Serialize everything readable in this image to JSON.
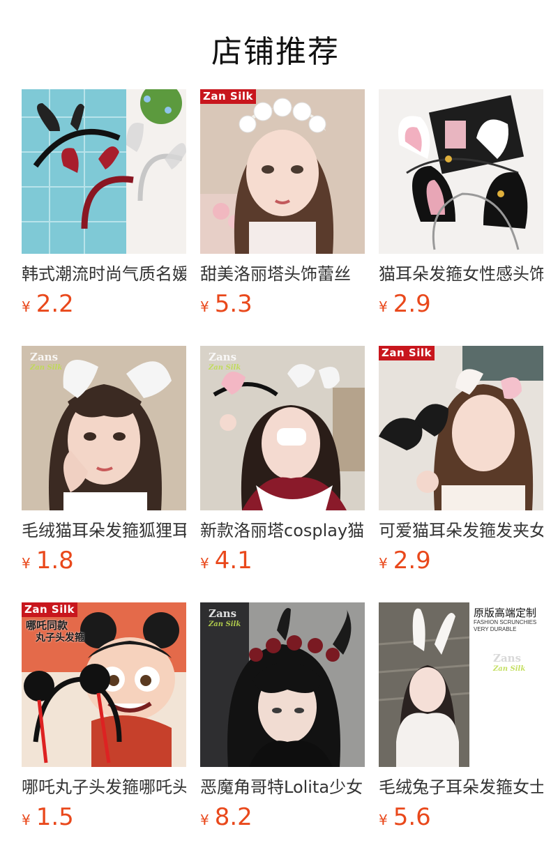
{
  "page": {
    "title": "店铺推荐"
  },
  "colors": {
    "price": "#e9481b",
    "brand_tag": "#c8161d"
  },
  "products": [
    {
      "title": "韩式潮流时尚气质名媛",
      "currency": "¥",
      "price": "2.2",
      "image_icon": "lace-bunny-ear-headbands-image"
    },
    {
      "title": "甜美洛丽塔头饰蕾丝",
      "currency": "¥",
      "price": "5.3",
      "image_icon": "lolita-lace-headband-model-image",
      "tag": "Zan Silk"
    },
    {
      "title": "猫耳朵发箍女性感头饰",
      "currency": "¥",
      "price": "2.9",
      "image_icon": "cat-ear-headbands-image"
    },
    {
      "title": "毛绒猫耳朵发箍狐狸耳",
      "currency": "¥",
      "price": "1.8",
      "image_icon": "plush-cat-ear-model-image",
      "watermark": "Zans",
      "watermark_sub": "Zan Silk"
    },
    {
      "title": "新款洛丽塔cosplay猫耳",
      "currency": "¥",
      "price": "4.1",
      "image_icon": "cosplay-cat-ear-model-image",
      "watermark": "Zans",
      "watermark_sub": "Zan Silk"
    },
    {
      "title": "可爱猫耳朵发箍发夹女",
      "currency": "¥",
      "price": "2.9",
      "image_icon": "cat-ear-clip-model-image",
      "tag": "Zan Silk"
    },
    {
      "title": "哪吒丸子头发箍哪吒头",
      "currency": "¥",
      "price": "1.5",
      "image_icon": "nezha-bun-headband-image",
      "tag": "Zan Silk",
      "overlay_line1": "哪吒同款",
      "overlay_line2": "丸子头发箍"
    },
    {
      "title": "恶魔角哥特Lolita少女",
      "currency": "¥",
      "price": "8.2",
      "image_icon": "devil-horn-gothic-model-image",
      "watermark": "Zans",
      "watermark_sub": "Zan Silk"
    },
    {
      "title": "毛绒兔子耳朵发箍女士",
      "currency": "¥",
      "price": "5.6",
      "image_icon": "bunny-ear-headband-image",
      "ad_title": "原版高端定制",
      "ad_sub1": "FASHION SCRUNCHIES",
      "ad_sub2": "VERY DURABLE",
      "watermark": "Zans",
      "watermark_sub": "Zan Silk"
    }
  ]
}
